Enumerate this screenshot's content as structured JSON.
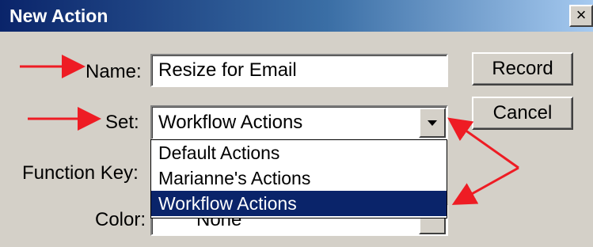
{
  "dialog": {
    "title": "New Action",
    "close_glyph": "×"
  },
  "form": {
    "name_label": "Name:",
    "name_value": "Resize for Email",
    "set_label": "Set:",
    "set_value": "Workflow Actions",
    "function_key_label": "Function Key:",
    "color_label": "Color:",
    "color_value": "None"
  },
  "buttons": {
    "record": "Record",
    "cancel": "Cancel"
  },
  "set_dropdown": {
    "options": [
      "Default Actions",
      "Marianne's Actions",
      "Workflow Actions"
    ],
    "selected": "Workflow Actions"
  },
  "colors": {
    "annotation_arrow": "#ee1c24",
    "selection": "#0a246a",
    "dialog_face": "#d4d0c8"
  },
  "icons": [
    "close-icon",
    "dropdown-arrow-icon",
    "annotation-arrow-icon"
  ]
}
